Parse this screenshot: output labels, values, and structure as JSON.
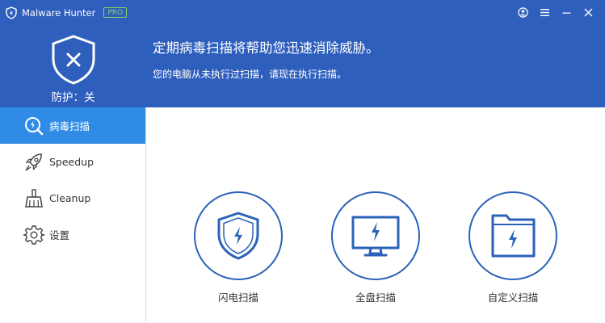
{
  "app": {
    "title": "Malware Hunter",
    "badge": "PRO"
  },
  "window_controls": [
    "account-icon",
    "menu-icon",
    "minimize-icon",
    "close-icon"
  ],
  "status": {
    "label": "防护：关"
  },
  "header": {
    "title": "定期病毒扫描将帮助您迅速消除威胁。",
    "subtitle": "您的电脑从未执行过扫描，请现在执行扫描。"
  },
  "sidebar": {
    "items": [
      {
        "label": "病毒扫描",
        "icon": "magnifier-bolt-icon",
        "active": true
      },
      {
        "label": "Speedup",
        "icon": "rocket-icon",
        "active": false
      },
      {
        "label": "Cleanup",
        "icon": "broom-icon",
        "active": false
      },
      {
        "label": "设置",
        "icon": "gear-icon",
        "active": false
      }
    ]
  },
  "scan_options": [
    {
      "label": "闪电扫描",
      "icon": "shield-bolt-icon"
    },
    {
      "label": "全盘扫描",
      "icon": "monitor-bolt-icon"
    },
    {
      "label": "自定义扫描",
      "icon": "folder-bolt-icon"
    }
  ],
  "colors": {
    "header_bg": "#2f5fbd",
    "active_nav_bg": "#2f8be5",
    "accent": "#2a62b8",
    "badge": "#7fd36b"
  }
}
